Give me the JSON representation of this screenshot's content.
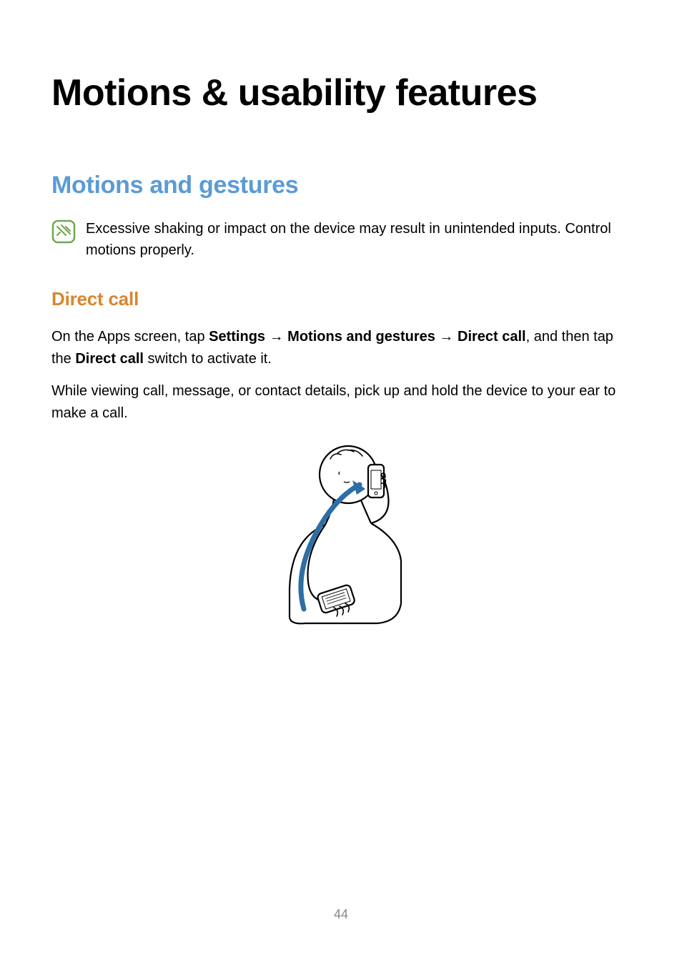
{
  "page_title": "Motions & usability features",
  "section_heading": "Motions and gestures",
  "note_text": "Excessive shaking or impact on the device may result in unintended inputs. Control motions properly.",
  "subsection_heading": "Direct call",
  "paragraph_1": {
    "pre": "On the Apps screen, tap ",
    "b1": "Settings",
    "arrow": " → ",
    "b2": "Motions and gestures",
    "b3": "Direct call",
    "mid": ", and then tap the ",
    "b4": "Direct call",
    "post": " switch to activate it."
  },
  "paragraph_2": "While viewing call, message, or contact details, pick up and hold the device to your ear to make a call.",
  "page_number": "44"
}
